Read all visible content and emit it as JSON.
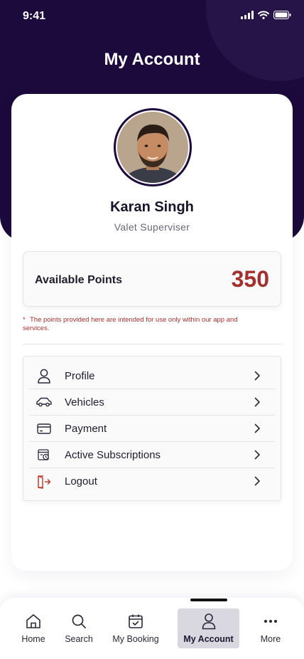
{
  "status_bar": {
    "time": "9:41"
  },
  "header": {
    "title": "My Account"
  },
  "profile": {
    "name": "Karan Singh",
    "role": "Valet Superviser"
  },
  "points": {
    "label": "Available Points",
    "value": "350",
    "note_marker": "*",
    "note": "The points provided here are intended for use only within our app and services."
  },
  "menu": {
    "items": [
      {
        "label": "Profile",
        "icon": "user-icon"
      },
      {
        "label": "Vehicles",
        "icon": "car-icon"
      },
      {
        "label": "Payment",
        "icon": "credit-card-icon"
      },
      {
        "label": "Active Subscriptions",
        "icon": "subscription-icon"
      },
      {
        "label": "Logout",
        "icon": "logout-icon"
      }
    ]
  },
  "tabbar": {
    "items": [
      {
        "label": "Home",
        "icon": "home-icon",
        "active": false
      },
      {
        "label": "Search",
        "icon": "search-icon",
        "active": false
      },
      {
        "label": "My Booking",
        "icon": "calendar-check-icon",
        "active": false
      },
      {
        "label": "My Account",
        "icon": "user-icon",
        "active": true
      },
      {
        "label": "More",
        "icon": "more-dots-icon",
        "active": false
      }
    ]
  },
  "colors": {
    "header_bg": "#1c0a3c",
    "points_accent": "#a2302f",
    "logout_icon": "#c0392b",
    "active_tab_bg": "#d9d8e0"
  }
}
